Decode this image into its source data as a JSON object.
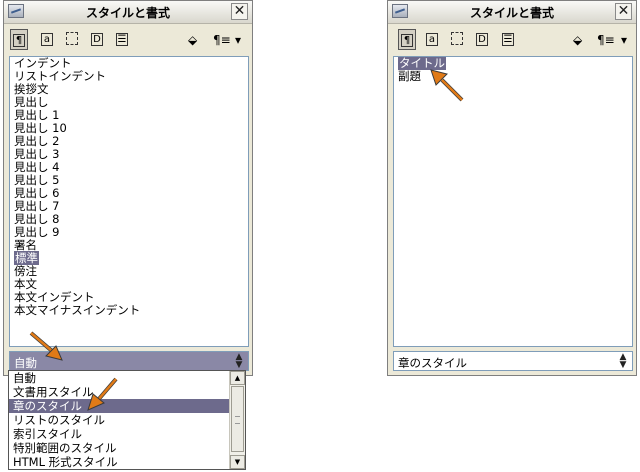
{
  "left_panel": {
    "title": "スタイルと書式",
    "close": "✕",
    "items": [
      "インデント",
      "リストインデント",
      "挨拶文",
      "見出し",
      "見出し 1",
      "見出し 10",
      "見出し 2",
      "見出し 3",
      "見出し 4",
      "見出し 5",
      "見出し 6",
      "見出し 7",
      "見出し 8",
      "見出し 9",
      "署名",
      "標準",
      "傍注",
      "本文",
      "本文インデント",
      "本文マイナスインデント"
    ],
    "selected_item": "標準",
    "combo_value": "自動",
    "dropdown_options": [
      "自動",
      "文書用スタイル",
      "章のスタイル",
      "リストのスタイル",
      "索引スタイル",
      "特別範囲のスタイル",
      "HTML 形式スタイル"
    ],
    "dropdown_highlighted": "章のスタイル"
  },
  "right_panel": {
    "title": "スタイルと書式",
    "close": "✕",
    "items": [
      "タイトル",
      "副題"
    ],
    "selected_item": "タイトル",
    "combo_value": "章のスタイル"
  },
  "toolbar": {
    "icons": [
      "paragraph-styles-icon",
      "character-styles-icon",
      "frame-styles-icon",
      "page-styles-icon",
      "list-styles-icon",
      "fill-format-icon",
      "new-style-icon",
      "dropdown-arrow-icon"
    ],
    "glyphs": {
      "para": "¶",
      "char": "a",
      "frame": "⬚",
      "page": "D",
      "list": "☰",
      "fill": "⬙",
      "new": "¶≡",
      "arrow": "▾"
    }
  },
  "colors": {
    "selection": "#6d6a8c",
    "arrow": "#e07a17",
    "panel_bg": "#ece9d8"
  }
}
